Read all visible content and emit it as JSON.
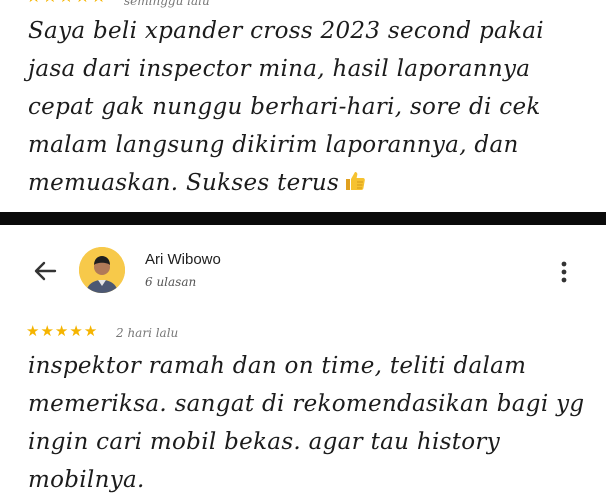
{
  "top_review": {
    "stars": [
      "★",
      "★",
      "★",
      "★",
      "★"
    ],
    "date": "seminggu lalu",
    "text": "Saya beli xpander cross 2023 second pakai jasa dari inspector mina, hasil laporannya cepat gak nunggu berhari-hari, sore di cek malam langsung dikirim laporannya, dan memuaskan. Sukses terus",
    "emoji_icon": "thumbs-up-icon"
  },
  "bottom_review": {
    "reviewer_name": "Ari Wibowo",
    "review_count": "6 ulasan",
    "stars": [
      "★",
      "★",
      "★",
      "★",
      "★"
    ],
    "date": "2 hari lalu",
    "text": "inspektor ramah dan on time, teliti dalam memeriksa. sangat di rekomendasikan bagi yg ingin cari mobil bekas. agar tau history mobilnya."
  },
  "colors": {
    "star": "#f5b400",
    "divider": "#0a0a0a",
    "avatar_bg": "#f7c94a"
  }
}
